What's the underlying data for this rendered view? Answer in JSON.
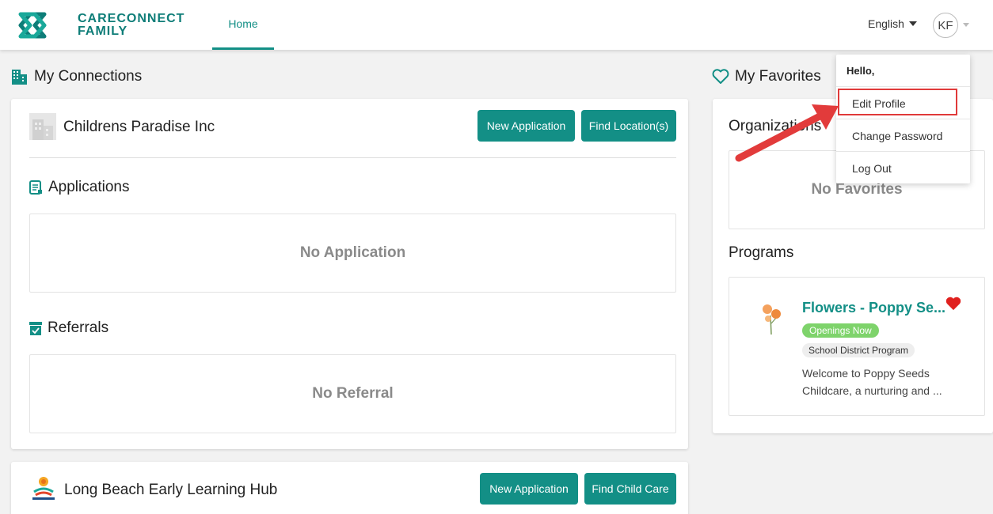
{
  "header": {
    "logo_line1": "CARECONNECT",
    "logo_line2": "FAMILY",
    "nav_home": "Home",
    "language": "English",
    "avatar_initials": "KF"
  },
  "connections": {
    "title": "My Connections",
    "org1": {
      "name": "Childrens Paradise Inc",
      "btn_new": "New Application",
      "btn_find": "Find Location(s)",
      "applications_title": "Applications",
      "applications_empty": "No Application",
      "referrals_title": "Referrals",
      "referrals_empty": "No Referral"
    },
    "org2": {
      "name": "Long Beach Early Learning Hub",
      "btn_new": "New Application",
      "btn_find": "Find Child Care"
    }
  },
  "favorites": {
    "title": "My Favorites",
    "organizations_title": "Organizations",
    "organizations_empty": "No Favorites",
    "programs_title": "Programs",
    "program": {
      "title": "Flowers - Poppy Se...",
      "badge_open": "Openings Now",
      "badge_type": "School District Program",
      "description": "Welcome to Poppy Seeds Childcare, a nurturing and ..."
    }
  },
  "user_menu": {
    "hello": "Hello,",
    "edit_profile": "Edit Profile",
    "change_password": "Change Password",
    "log_out": "Log Out"
  },
  "colors": {
    "brand_teal": "#138f86",
    "badge_green": "#7ed36b",
    "highlight_red": "#e03a3a",
    "heart_red": "#e0201e"
  }
}
